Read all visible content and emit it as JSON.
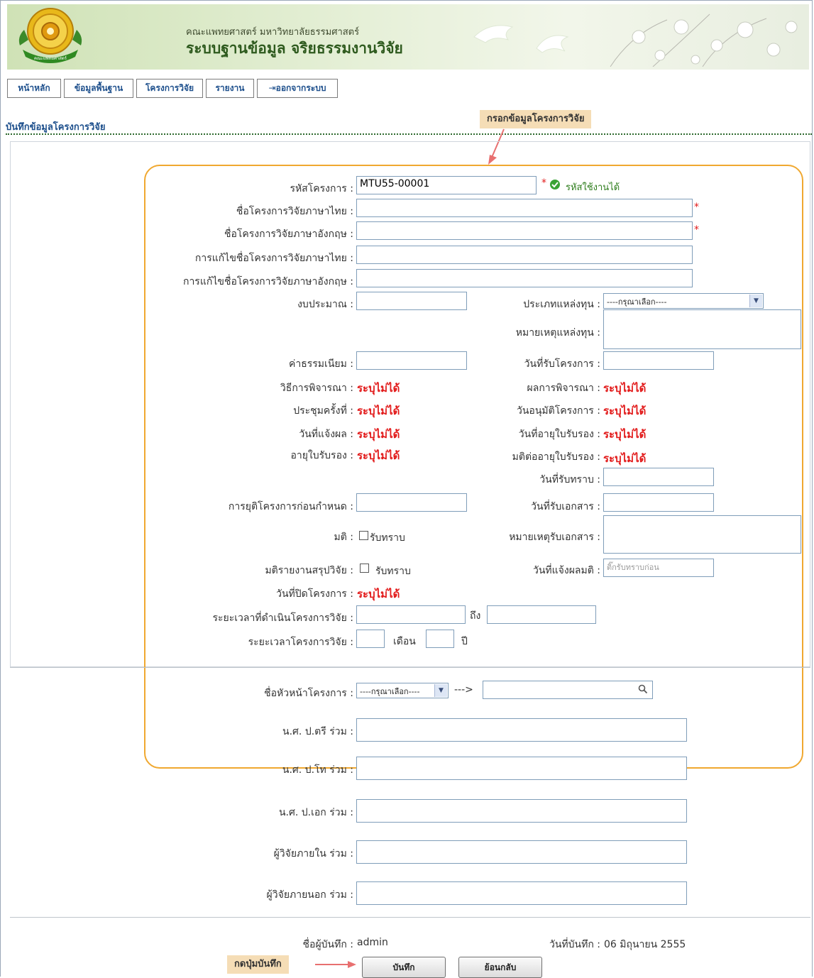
{
  "header": {
    "subtitle": "คณะแพทยศาสตร์ มหาวิทยาลัยธรรมศาสตร์",
    "title": "ระบบฐานข้อมูล จริยธรรมงานวิจัย",
    "logo_text": "คณะแพทยศาสตร์"
  },
  "nav": {
    "items": [
      "หน้าหลัก",
      "ข้อมูลพื้นฐาน",
      "โครงการวิจัย",
      "รายงาน",
      "ออกจากระบบ"
    ]
  },
  "section_title": "บันทึกข้อมูลโครงการวิจัย",
  "annotations": {
    "fill_note": "กรอกข้อมูลโครงการวิจัย",
    "save_note": "กดปุ่มบันทึก"
  },
  "form": {
    "project_code": {
      "label": "รหัสโครงการ :",
      "value": "MTU55-00001",
      "status": "รหัสใช้งานได้"
    },
    "name_th": {
      "label": "ชื่อโครงการวิจัยภาษาไทย :"
    },
    "name_en": {
      "label": "ชื่อโครงการวิจัยภาษาอังกฤษ :"
    },
    "edit_name_th": {
      "label": "การแก้ไขชื่อโครงการวิจัยภาษาไทย :"
    },
    "edit_name_en": {
      "label": "การแก้ไขชื่อโครงการวิจัยภาษาอังกฤษ :"
    },
    "budget": {
      "label": "งบประมาณ :"
    },
    "fund_type": {
      "label": "ประเภทแหล่งทุน :",
      "value": "----กรุณาเลือก----"
    },
    "fund_note": {
      "label": "หมายเหตุแหล่งทุน :"
    },
    "fee": {
      "label": "ค่าธรรมเนียม :"
    },
    "receive_date": {
      "label": "วันที่รับโครงการ :"
    },
    "review_method": {
      "label": "วิธีการพิจารณา :",
      "value": "ระบุไม่ได้"
    },
    "review_result": {
      "label": "ผลการพิจารณา :",
      "value": "ระบุไม่ได้"
    },
    "meeting_no": {
      "label": "ประชุมครั้งที่ :",
      "value": "ระบุไม่ได้"
    },
    "approve_date": {
      "label": "วันอนุมัติโครงการ :",
      "value": "ระบุไม่ได้"
    },
    "notify_date": {
      "label": "วันที่แจ้งผล :",
      "value": "ระบุไม่ได้"
    },
    "cert_renew_date": {
      "label": "วันที่อายุใบรับรอง :",
      "value": "ระบุไม่ได้"
    },
    "cert_age": {
      "label": "อายุใบรับรอง :",
      "value": "ระบุไม่ได้"
    },
    "cert_renew_resolution": {
      "label": "มติต่ออายุใบรับรอง :",
      "value": "ระบุไม่ได้"
    },
    "acknowledge_date": {
      "label": "วันที่รับทราบ :"
    },
    "early_termination": {
      "label": "การยุติโครงการก่อนกำหนด :"
    },
    "doc_receive_date": {
      "label": "วันที่รับเอกสาร :"
    },
    "resolution": {
      "label": "มติ :",
      "checkbox": "รับทราบ"
    },
    "doc_note": {
      "label": "หมายเหตุรับเอกสาร :"
    },
    "summary_resolution": {
      "label": "มติรายงานสรุปวิจัย :",
      "checkbox": "รับทราบ"
    },
    "resolution_notify_date": {
      "label": "วันที่แจ้งผลมติ :",
      "placeholder": "ติ๊กรับทราบก่อน"
    },
    "close_date": {
      "label": "วันที่ปิดโครงการ :",
      "value": "ระบุไม่ได้"
    },
    "duration_range": {
      "label": "ระยะเวลาที่ดำเนินโครงการวิจัย :",
      "to": "ถึง"
    },
    "duration": {
      "label": "ระยะเวลาโครงการวิจัย :",
      "month": "เดือน",
      "year": "ปี"
    },
    "head": {
      "label": "ชื่อหัวหน้าโครงการ :",
      "select": "----กรุณาเลือก----",
      "arrow": "--->"
    },
    "bachelor": {
      "label": "น.ศ. ป.ตรี ร่วม :"
    },
    "master": {
      "label": "น.ศ. ป.โท ร่วม :"
    },
    "doctoral": {
      "label": "น.ศ. ป.เอก ร่วม :"
    },
    "internal": {
      "label": "ผู้วิจัยภายใน ร่วม :"
    },
    "external": {
      "label": "ผู้วิจัยภายนอก ร่วม :"
    }
  },
  "footer": {
    "recorder_label": "ชื่อผู้บันทึก :",
    "recorder_value": "admin",
    "date_label": "วันที่บันทึก :",
    "date_value": "06 มิถุนายน 2555",
    "save_button": "บันทึก",
    "back_button": "ย้อนกลับ"
  },
  "colors": {
    "orange": "#f0a830",
    "red": "#e21a1a",
    "nav_text": "#1d4f8c",
    "note_bg": "#f5ddb6"
  }
}
